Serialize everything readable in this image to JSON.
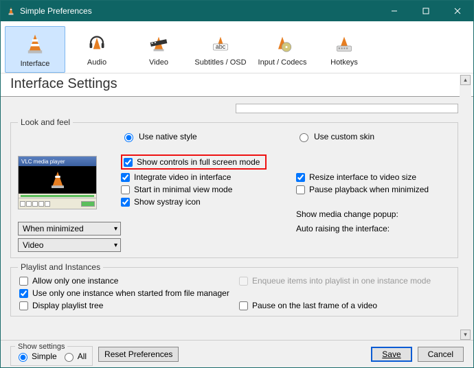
{
  "window": {
    "title": "Simple Preferences"
  },
  "tabs": [
    {
      "id": "interface",
      "label": "Interface"
    },
    {
      "id": "audio",
      "label": "Audio"
    },
    {
      "id": "video",
      "label": "Video"
    },
    {
      "id": "subtitles",
      "label": "Subtitles / OSD"
    },
    {
      "id": "input",
      "label": "Input / Codecs"
    },
    {
      "id": "hotkeys",
      "label": "Hotkeys"
    }
  ],
  "section_title": "Interface Settings",
  "look_and_feel": {
    "legend": "Look and feel",
    "style": {
      "native_label": "Use native style",
      "custom_label": "Use custom skin",
      "selected": "native"
    },
    "checks": {
      "full_screen": {
        "label": "Show controls in full screen mode",
        "checked": true
      },
      "integrate": {
        "label": "Integrate video in interface",
        "checked": true
      },
      "resize": {
        "label": "Resize interface to video size",
        "checked": true
      },
      "minimal": {
        "label": "Start in minimal view mode",
        "checked": false
      },
      "pause_min": {
        "label": "Pause playback when minimized",
        "checked": false
      },
      "systray": {
        "label": "Show systray icon",
        "checked": true
      }
    },
    "media_popup": {
      "label": "Show media change popup:",
      "value": "When minimized"
    },
    "auto_raise": {
      "label": "Auto raising the interface:",
      "value": "Video"
    },
    "thumb_title": "VLC media player"
  },
  "playlist": {
    "legend": "Playlist and Instances",
    "allow_one": {
      "label": "Allow only one instance",
      "checked": false
    },
    "enqueue": {
      "label": "Enqueue items into playlist in one instance mode",
      "checked": false,
      "disabled": true
    },
    "use_one_fm": {
      "label": "Use only one instance when started from file manager",
      "checked": true
    },
    "display_tree": {
      "label": "Display playlist tree",
      "checked": false
    },
    "pause_last": {
      "label": "Pause on the last frame of a video",
      "checked": false
    }
  },
  "footer": {
    "show_settings_legend": "Show settings",
    "simple_label": "Simple",
    "all_label": "All",
    "reset_label": "Reset Preferences",
    "save_label": "Save",
    "cancel_label": "Cancel"
  }
}
